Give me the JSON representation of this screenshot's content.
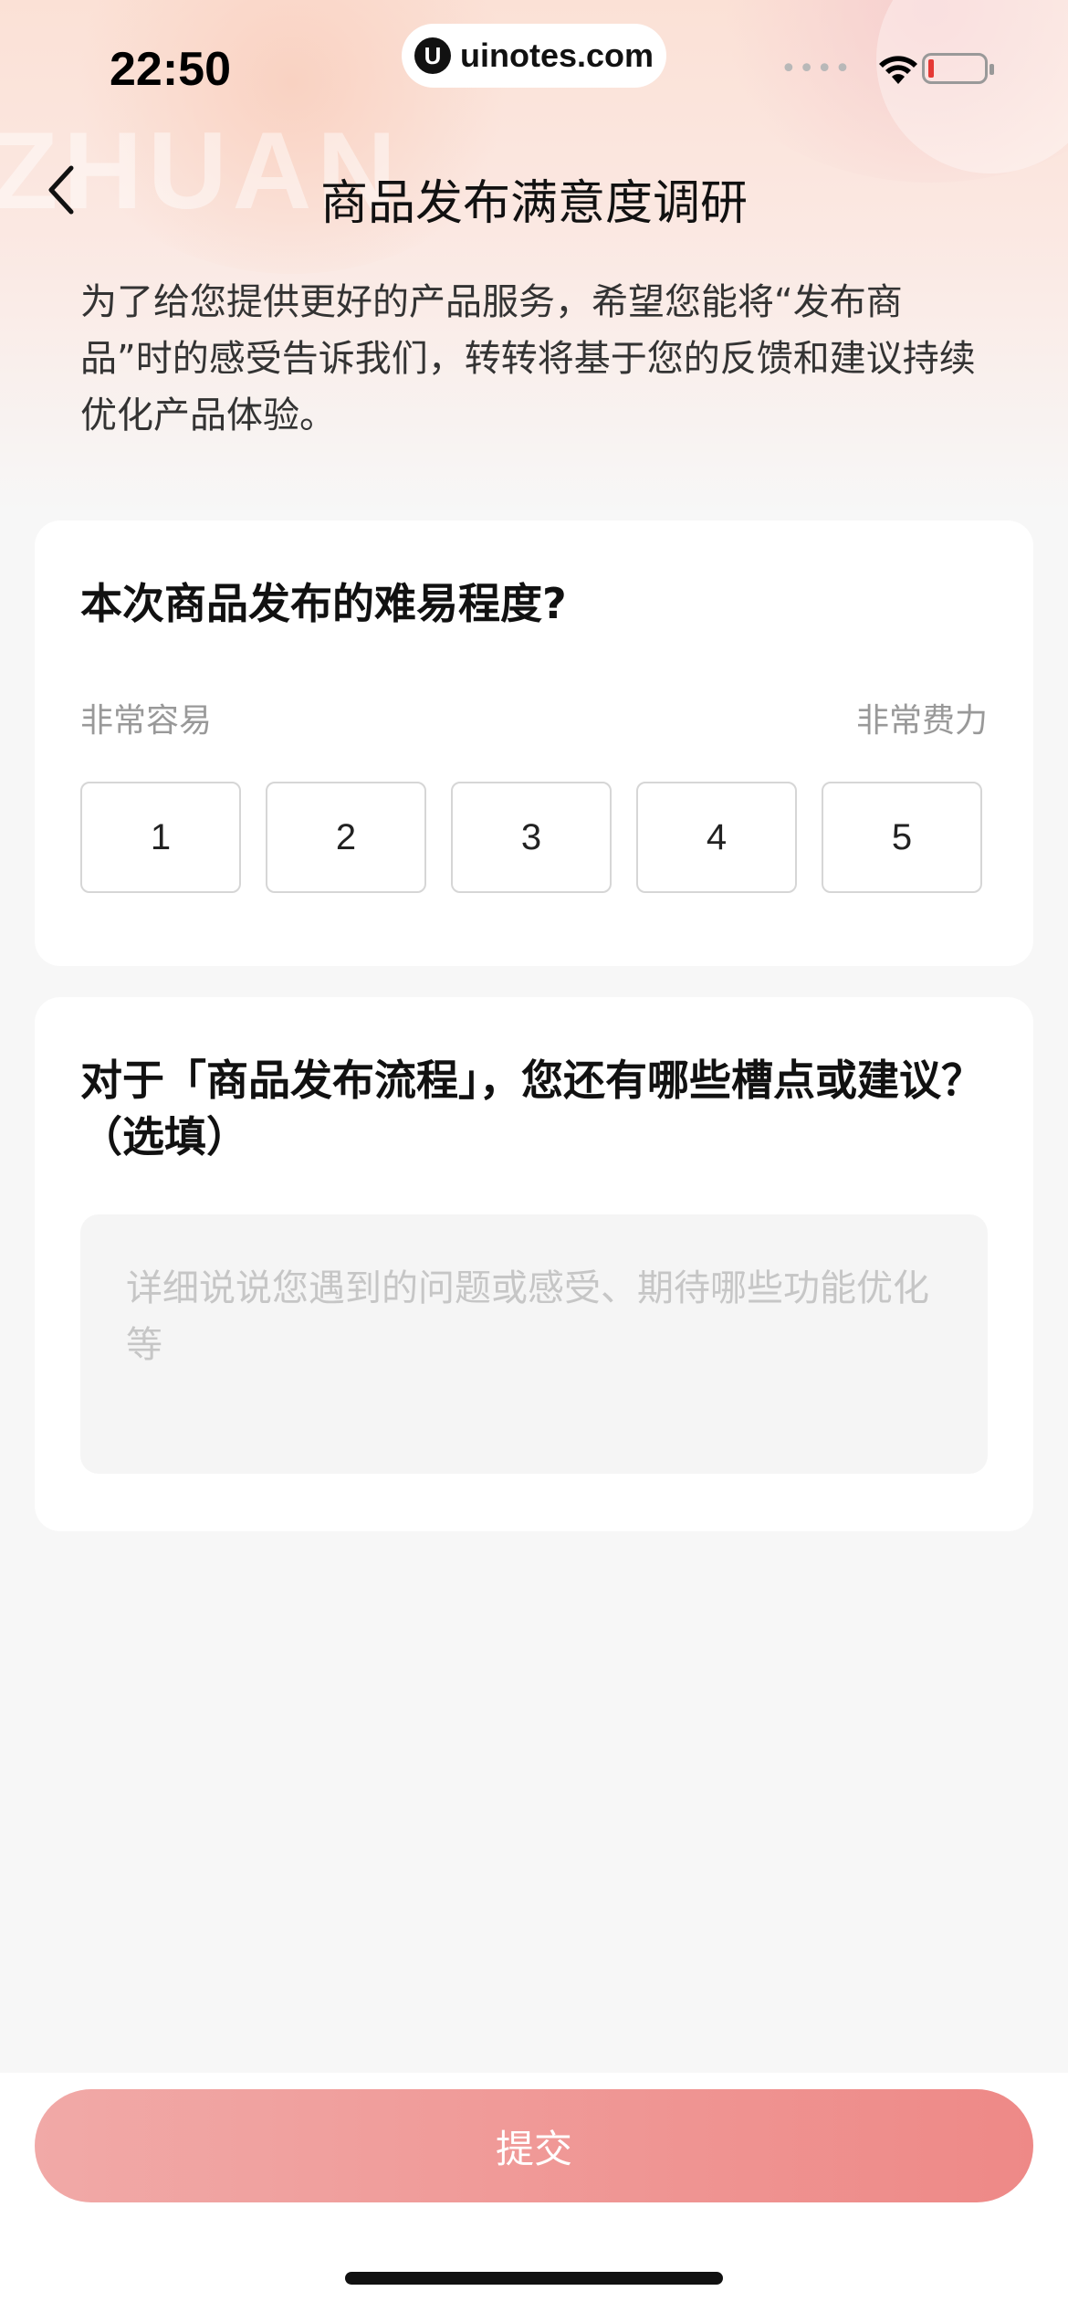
{
  "status_bar": {
    "time": "22:50",
    "site_logo": "U",
    "site": "uinotes.com",
    "signal_icon": "••••",
    "battery_color": "#e53935"
  },
  "nav": {
    "back_icon": "chevron-left-icon",
    "title": "商品发布满意度调研"
  },
  "intro": "为了给您提供更好的产品服务，希望您能将“发布商品”时的感受告诉我们，转转将基于您的反馈和建议持续优化产品体验。",
  "question1": {
    "title": "本次商品发布的难易程度?",
    "scale_min_label": "非常容易",
    "scale_max_label": "非常费力",
    "options": [
      "1",
      "2",
      "3",
      "4",
      "5"
    ]
  },
  "question2": {
    "title": "对于「商品发布流程」，您还有哪些槽点或建议？（选填）",
    "placeholder": "详细说说您遇到的问题或感受、期待哪些功能优化等"
  },
  "footer": {
    "submit_label": "提交",
    "submit_color": "#ee8987"
  }
}
